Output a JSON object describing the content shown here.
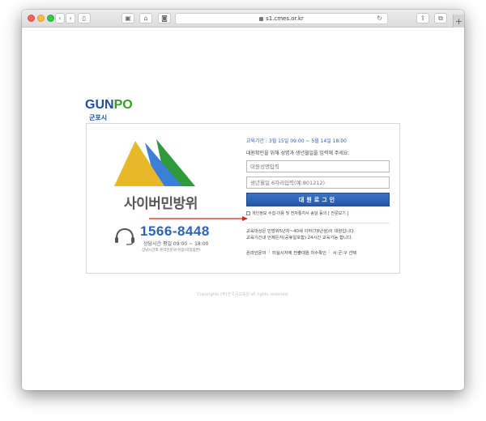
{
  "browser": {
    "url": "s1.cmes.or.kr"
  },
  "logo": {
    "text_main": "GUN",
    "text_po": "PO",
    "subtitle": "군포시"
  },
  "left": {
    "brand": "사이버민방위",
    "phone": "1566-8448",
    "hours": "상담시간  평일  09:00 ~ 18:00",
    "hours_note": "상담시간외 온라인문의 이용(익일답변)"
  },
  "form": {
    "period": "교육기간  :  3월 15일 09:00 ~ 5월 14일 18:00",
    "instruction": "대원확인을 위해 성명과 생년월일을 입력해 주세요.",
    "name_placeholder": "대원성명입력",
    "birth_placeholder": "생년월일 6자리입력(예:801212)",
    "login_label": "대원로그인",
    "consent_text": "개인정보 수집·이용 및 전자통지서 송달 동의 [ 전문보기 ]",
    "note_line1": "교육대상은 민방위5년차~40세 이하(78년생)의 대원입니다.",
    "note_line2": "교육기간내 언제든지(공휴일포함) 24시간 교육가능 합니다."
  },
  "links": {
    "inquiry": "온라인문의",
    "sep": "|",
    "notice": "미실시자에 전출대원 이수확인",
    "region": "시·군·구 선택"
  },
  "footer": {
    "copyright": "Copyrights (주)한국공교육원 all rights reserved."
  },
  "colors": {
    "accent_blue": "#2d63b8",
    "logo_green": "#3a9a2e",
    "mountain_yellow": "#e6b82a",
    "mountain_blue": "#3b7fd6",
    "mountain_green": "#2e9a3a",
    "arrow_red": "#d9261c"
  }
}
